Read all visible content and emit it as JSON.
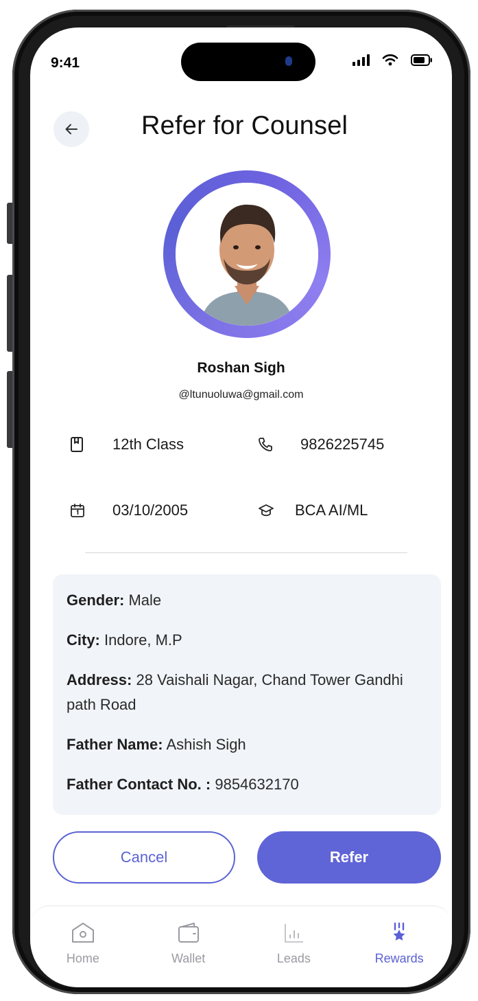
{
  "status_bar": {
    "time": "9:41"
  },
  "header": {
    "title": "Refer for Counsel"
  },
  "profile": {
    "name": "Roshan Sigh",
    "email": "@ltunuoluwa@gmail.com"
  },
  "info": {
    "class": "12th Class",
    "phone": "9826225745",
    "dob": "03/10/2005",
    "course": "BCA AI/ML"
  },
  "details": {
    "gender_label": "Gender:",
    "gender_value": " Male",
    "city_label": "City:",
    "city_value": " Indore, M.P",
    "address_label": "Address:",
    "address_value": " 28 Vaishali Nagar, Chand Tower Gandhi path Road",
    "father_label": "Father Name:",
    "father_value": " Ashish Sigh",
    "father_contact_label": "Father Contact No. :",
    "father_contact_value": " 9854632170"
  },
  "actions": {
    "cancel": "Cancel",
    "refer": "Refer"
  },
  "tabbar": {
    "items": [
      {
        "label": "Home",
        "icon": "home-icon"
      },
      {
        "label": "Wallet",
        "icon": "wallet-icon"
      },
      {
        "label": "Leads",
        "icon": "leads-icon"
      },
      {
        "label": "Rewards",
        "icon": "rewards-icon"
      }
    ],
    "active": "Rewards"
  },
  "colors": {
    "accent": "#5f64d6",
    "panel": "#f1f4f8",
    "muted": "#9a9aa2"
  }
}
